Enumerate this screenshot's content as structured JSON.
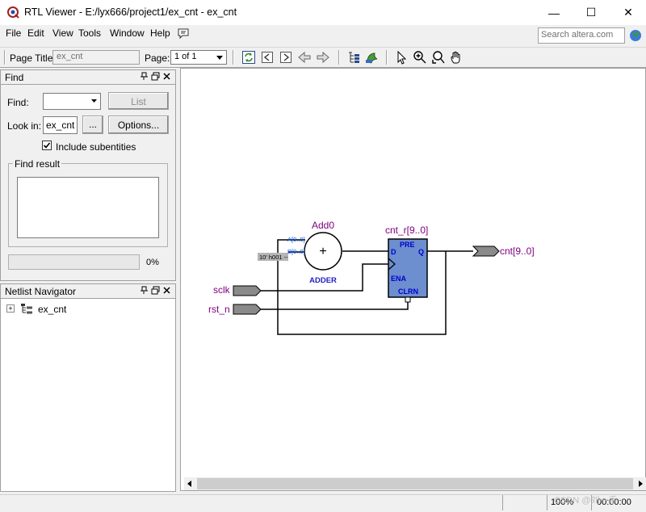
{
  "window": {
    "title": "RTL Viewer - E:/lyx666/project1/ex_cnt - ex_cnt",
    "controls": {
      "minimize": "—",
      "maximize": "☐",
      "close": "✕"
    }
  },
  "menu": {
    "items": [
      "File",
      "Edit",
      "View",
      "Tools",
      "Window",
      "Help"
    ],
    "search_placeholder": "Search altera.com"
  },
  "toolbar": {
    "page_title_label": "Page Title:",
    "page_title_value": "ex_cnt",
    "page_label": "Page:",
    "page_value": "1 of 1"
  },
  "find_panel": {
    "title": "Find",
    "find_label": "Find:",
    "find_value": "",
    "list_button": "List",
    "look_in_label": "Look in:",
    "look_in_value": "ex_cnt",
    "browse_button": "...",
    "options_button": "Options...",
    "include_subentities_label": "Include subentities",
    "include_subentities_checked": true,
    "find_result_label": "Find result",
    "progress_percent": "0%",
    "progress_fraction": 0
  },
  "netlist_panel": {
    "title": "Netlist Navigator",
    "tree_root": "ex_cnt",
    "expander": "+"
  },
  "schematic": {
    "adder_name": "Add0",
    "adder_symbol": "+",
    "adder_type": "ADDER",
    "adder_port_a": "A[9..0]",
    "adder_port_b": "B[9..0]",
    "constant": "10' h001 --",
    "reg_name": "cnt_r[9..0]",
    "reg_pre": "PRE",
    "reg_d": "D",
    "reg_q": "Q",
    "reg_ena": "ENA",
    "reg_clrn": "CLRN",
    "input_clk": "sclk",
    "input_rst": "rst_n",
    "output_cnt": "cnt[9..0]",
    "colors": {
      "pin_label": "#800080",
      "port_label": "#0000ff",
      "reg_fill": "#6d8ecf",
      "pin_fill": "#8a8a8a"
    }
  },
  "statusbar": {
    "zoom": "100%",
    "time": "00:00:00",
    "watermark": "CSDN @刘一手"
  }
}
